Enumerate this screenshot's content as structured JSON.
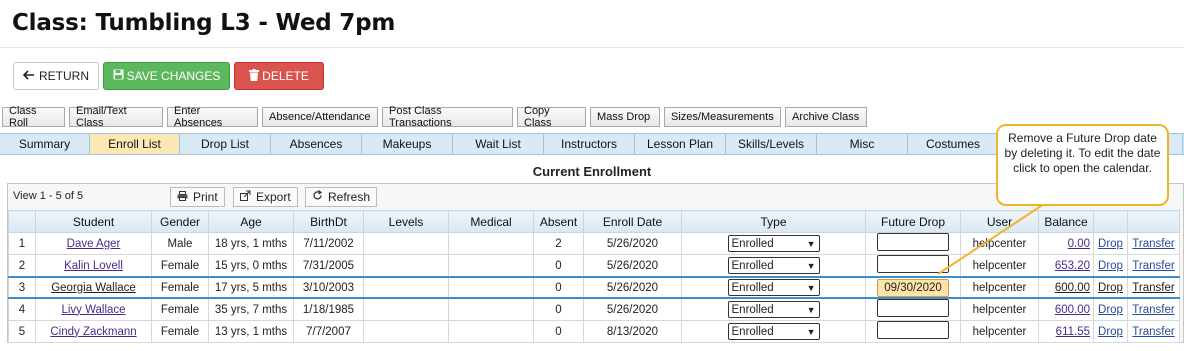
{
  "page": {
    "title": "Class: Tumbling L3 - Wed 7pm"
  },
  "actions": {
    "return_label": "RETURN",
    "save_label": "SAVE CHANGES",
    "delete_label": "DELETE"
  },
  "tools": [
    "Class Roll",
    "Email/Text Class",
    "Enter Absences",
    "Absence/Attendance",
    "Post Class Transactions",
    "Copy Class",
    "Mass Drop",
    "Sizes/Measurements",
    "Archive Class"
  ],
  "tabs": [
    "Summary",
    "Enroll List",
    "Drop List",
    "Absences",
    "Makeups",
    "Wait List",
    "Instructors",
    "Lesson Plan",
    "Skills/Levels",
    "Misc",
    "Costumes",
    "",
    ""
  ],
  "active_tab": "Enroll List",
  "section_title": "Current Enrollment",
  "grid": {
    "view_text": "View 1 - 5 of 5",
    "print_label": "Print",
    "export_label": "Export",
    "refresh_label": "Refresh",
    "columns": [
      "",
      "Student",
      "Gender",
      "Age",
      "BirthDt",
      "Levels",
      "Medical",
      "Absent",
      "Enroll Date",
      "Type",
      "Future Drop",
      "User",
      "Balance",
      "",
      ""
    ],
    "rows": [
      {
        "n": "1",
        "student": "Dave Ager",
        "gender": "Male",
        "age": "18 yrs, 1 mths",
        "birth": "7/11/2002",
        "levels": "",
        "medical": "",
        "absent": "2",
        "enroll": "5/26/2020",
        "type": "Enrolled",
        "future_drop": "",
        "user": "helpcenter",
        "balance": "0.00",
        "drop": "Drop",
        "transfer": "Transfer"
      },
      {
        "n": "2",
        "student": "Kalin Lovell",
        "gender": "Female",
        "age": "15 yrs, 0 mths",
        "birth": "7/31/2005",
        "levels": "",
        "medical": "",
        "absent": "0",
        "enroll": "5/26/2020",
        "type": "Enrolled",
        "future_drop": "",
        "user": "helpcenter",
        "balance": "653.20",
        "drop": "Drop",
        "transfer": "Transfer"
      },
      {
        "n": "3",
        "student": "Georgia Wallace",
        "gender": "Female",
        "age": "17 yrs, 5 mths",
        "birth": "3/10/2003",
        "levels": "",
        "medical": "",
        "absent": "0",
        "enroll": "5/26/2020",
        "type": "Enrolled",
        "future_drop": "09/30/2020",
        "user": "helpcenter",
        "balance": "600.00",
        "drop": "Drop",
        "transfer": "Transfer"
      },
      {
        "n": "4",
        "student": "Livy Wallace",
        "gender": "Female",
        "age": "35 yrs, 7 mths",
        "birth": "1/18/1985",
        "levels": "",
        "medical": "",
        "absent": "0",
        "enroll": "5/26/2020",
        "type": "Enrolled",
        "future_drop": "",
        "user": "helpcenter",
        "balance": "600.00",
        "drop": "Drop",
        "transfer": "Transfer"
      },
      {
        "n": "5",
        "student": "Cindy Zackmann",
        "gender": "Female",
        "age": "13 yrs, 1 mths",
        "birth": "7/7/2007",
        "levels": "",
        "medical": "",
        "absent": "0",
        "enroll": "8/13/2020",
        "type": "Enrolled",
        "future_drop": "",
        "user": "helpcenter",
        "balance": "611.55",
        "drop": "Drop",
        "transfer": "Transfer"
      }
    ]
  },
  "callout": {
    "text": "Remove a Future Drop date by deleting it. To edit the date click to open the calendar."
  },
  "icons": {
    "return": "arrow-left-icon",
    "save": "floppy-disk-icon",
    "delete": "trash-icon",
    "print": "printer-icon",
    "export": "export-icon",
    "refresh": "refresh-icon",
    "dropdown": "chevron-down-icon"
  },
  "colors": {
    "save": "#5cb85c",
    "delete": "#d9534f",
    "callout_border": "#f0b429",
    "active_tab": "#fbe8b3",
    "tab_bar": "#cfe3f2"
  }
}
